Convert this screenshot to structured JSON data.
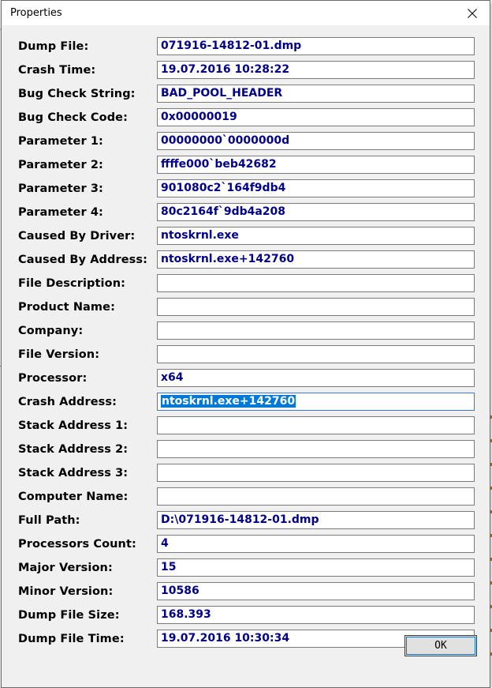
{
  "dialog": {
    "title": "Properties",
    "ok_label": "OK"
  },
  "fields": [
    {
      "label": "Dump File:",
      "value": "071916-14812-01.dmp"
    },
    {
      "label": "Crash Time:",
      "value": "19.07.2016 10:28:22"
    },
    {
      "label": "Bug Check String:",
      "value": "BAD_POOL_HEADER"
    },
    {
      "label": "Bug Check Code:",
      "value": "0x00000019"
    },
    {
      "label": "Parameter 1:",
      "value": "00000000`0000000d"
    },
    {
      "label": "Parameter 2:",
      "value": "ffffe000`beb42682"
    },
    {
      "label": "Parameter 3:",
      "value": "901080c2`164f9db4"
    },
    {
      "label": "Parameter 4:",
      "value": "80c2164f`9db4a208"
    },
    {
      "label": "Caused By Driver:",
      "value": "ntoskrnl.exe"
    },
    {
      "label": "Caused By Address:",
      "value": "ntoskrnl.exe+142760"
    },
    {
      "label": "File Description:",
      "value": ""
    },
    {
      "label": "Product Name:",
      "value": ""
    },
    {
      "label": "Company:",
      "value": ""
    },
    {
      "label": "File Version:",
      "value": ""
    },
    {
      "label": "Processor:",
      "value": "x64"
    },
    {
      "label": "Crash Address:",
      "value": "ntoskrnl.exe+142760"
    },
    {
      "label": "Stack Address 1:",
      "value": ""
    },
    {
      "label": "Stack Address 2:",
      "value": ""
    },
    {
      "label": "Stack Address 3:",
      "value": ""
    },
    {
      "label": "Computer Name:",
      "value": ""
    },
    {
      "label": "Full Path:",
      "value": "D:\\071916-14812-01.dmp"
    },
    {
      "label": "Processors Count:",
      "value": "4"
    },
    {
      "label": "Major Version:",
      "value": "15"
    },
    {
      "label": "Minor Version:",
      "value": "10586"
    },
    {
      "label": "Dump File Size:",
      "value": "168.393"
    },
    {
      "label": "Dump File Time:",
      "value": "19.07.2016 10:30:34"
    }
  ],
  "background": {
    "glyph_top": "ar",
    "glyph_second": ".0"
  },
  "colors": {
    "value_text": "#00008b",
    "selection": "#0078d7",
    "dialog_bg": "#f0f0f0"
  }
}
